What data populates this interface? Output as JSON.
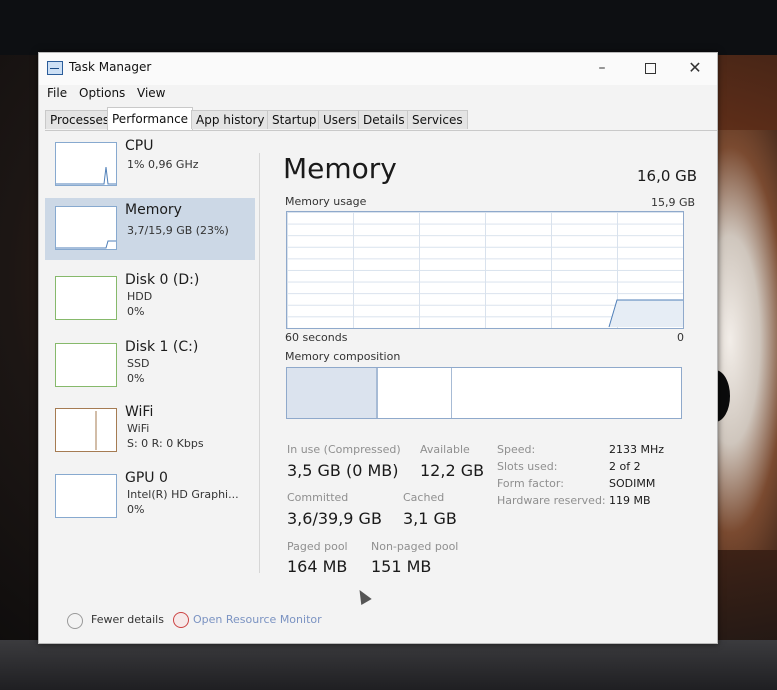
{
  "window": {
    "title": "Task Manager",
    "controls": {
      "minimize": "–",
      "close": "✕"
    }
  },
  "menu": [
    "File",
    "Options",
    "View"
  ],
  "tabs": [
    "Processes",
    "Performance",
    "App history",
    "Startup",
    "Users",
    "Details",
    "Services"
  ],
  "active_tab": "Performance",
  "sidebar": [
    {
      "name": "CPU",
      "line1": "1% 0,96 GHz",
      "line2": ""
    },
    {
      "name": "Memory",
      "line1": "3,7/15,9 GB (23%)",
      "line2": "",
      "selected": true
    },
    {
      "name": "Disk 0 (D:)",
      "line1": "HDD",
      "line2": "0%"
    },
    {
      "name": "Disk 1 (C:)",
      "line1": "SSD",
      "line2": "0%"
    },
    {
      "name": "WiFi",
      "line1": "WiFi",
      "line2": "S: 0 R: 0 Kbps"
    },
    {
      "name": "GPU 0",
      "line1": "Intel(R) HD Graphi...",
      "line2": "0%"
    }
  ],
  "main": {
    "title": "Memory",
    "total": "16,0 GB",
    "usage_label": "Memory usage",
    "usage_max": "15,9 GB",
    "x_left": "60 seconds",
    "x_right": "0",
    "composition_label": "Memory composition",
    "stats": {
      "in_use_label": "In use (Compressed)",
      "in_use_value": "3,5 GB (0 MB)",
      "available_label": "Available",
      "available_value": "12,2 GB",
      "committed_label": "Committed",
      "committed_value": "3,6/39,9 GB",
      "cached_label": "Cached",
      "cached_value": "3,1 GB",
      "paged_label": "Paged pool",
      "paged_value": "164 MB",
      "nonpaged_label": "Non-paged pool",
      "nonpaged_value": "151 MB"
    },
    "details": [
      {
        "label": "Speed:",
        "value": "2133 MHz"
      },
      {
        "label": "Slots used:",
        "value": "2 of 2"
      },
      {
        "label": "Form factor:",
        "value": "SODIMM"
      },
      {
        "label": "Hardware reserved:",
        "value": "119 MB"
      }
    ]
  },
  "footer": {
    "fewer_details": "Fewer details",
    "open_monitor": "Open Resource Monitor"
  },
  "colors": {
    "accent": "#87a9cf",
    "selected": "#ccd8e6",
    "disk": "#86b96b",
    "wifi": "#a57b52"
  }
}
